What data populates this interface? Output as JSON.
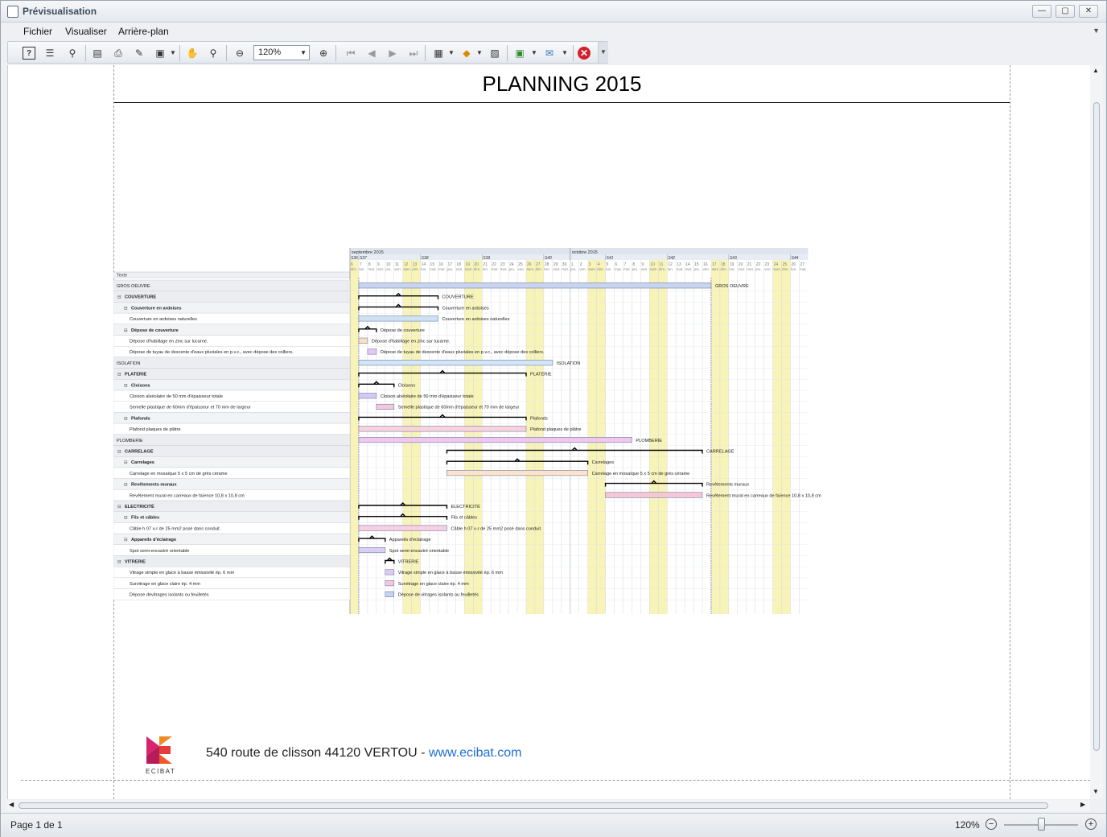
{
  "window": {
    "title": "Prévisualisation",
    "icon": "preview-icon"
  },
  "menu": {
    "items": [
      "Fichier",
      "Visualiser",
      "Arrière-plan"
    ]
  },
  "toolbar": {
    "zoom_value": "120%",
    "icons": [
      "help-icon",
      "document-map-icon",
      "find-icon",
      "page-setup-icon",
      "print-icon",
      "quick-print-icon",
      "export-icon",
      "hand-tool-icon",
      "magnifier-icon",
      "zoom-out-icon",
      "zoom-in-icon",
      "first-page-icon",
      "previous-page-icon",
      "next-page-icon",
      "last-page-icon",
      "multiple-pages-icon",
      "background-color-icon",
      "watermark-icon",
      "export-document-icon",
      "send-email-icon",
      "close-preview-icon"
    ]
  },
  "document": {
    "title": "PLANNING 2015",
    "footer_address": "540 route de clisson 44120 VERTOU - ",
    "footer_link": "www.ecibat.com",
    "logo_text": "ECIBAT",
    "logo_colors": [
      "#d6246e",
      "#f08a24",
      "#e43b3b",
      "#b71c5a"
    ]
  },
  "gantt": {
    "months": [
      "septembre 2015",
      "octobre 2015"
    ],
    "weeks": [
      {
        "label": "S36",
        "day": 6
      },
      {
        "label": "S37",
        "day": 7
      },
      {
        "label": "S38",
        "day": 14
      },
      {
        "label": "S39",
        "day": 21
      },
      {
        "label": "S40",
        "day": 28
      },
      {
        "label": "S41",
        "day": 5
      },
      {
        "label": "S42",
        "day": 12
      },
      {
        "label": "S43",
        "day": 19
      },
      {
        "label": "S44",
        "day": 26
      }
    ],
    "day_numbers": [
      "6",
      "7",
      "8",
      "9",
      "10",
      "11",
      "12",
      "13",
      "14",
      "15",
      "16",
      "17",
      "18",
      "19",
      "20",
      "21",
      "22",
      "23",
      "24",
      "25",
      "26",
      "27",
      "28",
      "29",
      "30",
      "1",
      "2",
      "3",
      "4",
      "5",
      "6",
      "7",
      "8",
      "9",
      "10",
      "11",
      "12",
      "13",
      "14",
      "15",
      "16",
      "17",
      "18",
      "19",
      "20",
      "21",
      "22",
      "23",
      "24",
      "25",
      "26",
      "27"
    ],
    "day_names": [
      "dim.",
      "lun.",
      "mar.",
      "mer.",
      "jeu.",
      "ven.",
      "sam.",
      "dim.",
      "lun.",
      "mar.",
      "mer.",
      "jeu.",
      "ven.",
      "sam.",
      "dim.",
      "lun.",
      "mar.",
      "mer.",
      "jeu.",
      "ven.",
      "sam.",
      "dim.",
      "lun.",
      "mar.",
      "mer.",
      "jeu.",
      "ven.",
      "sam.",
      "dim.",
      "lun.",
      "mar.",
      "mer.",
      "jeu.",
      "ven.",
      "sam.",
      "dim.",
      "lun.",
      "mar.",
      "mer.",
      "jeu.",
      "ven.",
      "sam.",
      "dim.",
      "lun.",
      "mar.",
      "mer.",
      "jeu.",
      "ven.",
      "sam.",
      "dim.",
      "lun.",
      "mar."
    ],
    "column_header": "Texte",
    "rows": [
      {
        "label": "GROS OEUVRE",
        "level": 0,
        "bold": false,
        "kind": "bar",
        "start": 1,
        "end": 41,
        "fill": "#c9d4ef",
        "bar_label": "GROS OEUVRE"
      },
      {
        "label": "COUVERTURE",
        "level": 0,
        "bold": true,
        "kind": "summary",
        "start": 1,
        "end": 10,
        "bar_label": "COUVERTURE"
      },
      {
        "label": "Couverture en ardoises",
        "level": 1,
        "bold": true,
        "kind": "summary",
        "start": 1,
        "end": 10,
        "bar_label": "Couverture en ardoises"
      },
      {
        "label": "Couverture en ardoises naturelles",
        "level": 2,
        "bold": false,
        "kind": "bar",
        "start": 1,
        "end": 10,
        "fill": "#cfe2f3",
        "bar_label": "Couverture en ardoises naturelles"
      },
      {
        "label": "Dépose de couverture",
        "level": 1,
        "bold": true,
        "kind": "summary",
        "start": 1,
        "end": 3,
        "bar_label": "Dépose de couverture"
      },
      {
        "label": "Dépose d'habillage en zinc sur lucarne.",
        "level": 2,
        "bold": false,
        "kind": "bar",
        "start": 1,
        "end": 2,
        "fill": "#fde0c4",
        "bar_label": "Dépose d'habillage en zinc sur lucarne."
      },
      {
        "label": "Dépose de tuyau de descente d'eaux pluviales en p.v.c., avec dépose des colliers.",
        "level": 2,
        "bold": false,
        "kind": "bar",
        "start": 2,
        "end": 3,
        "fill": "#e7c6f3",
        "bar_label": "Dépose de tuyau de descente d'eaux pluviales en p.v.c., avec dépose des colliers."
      },
      {
        "label": "ISOLATION",
        "level": 0,
        "bold": false,
        "kind": "bar",
        "start": 1,
        "end": 23,
        "fill": "#d3e6f5",
        "bar_label": "ISOLATION"
      },
      {
        "label": "PLATERIE",
        "level": 0,
        "bold": true,
        "kind": "summary",
        "start": 1,
        "end": 20,
        "bar_label": "PLATERIE"
      },
      {
        "label": "Cloisons",
        "level": 1,
        "bold": true,
        "kind": "summary",
        "start": 1,
        "end": 5,
        "bar_label": "Cloisons"
      },
      {
        "label": "Cloison alvéolaire de 50 mm d'épaisseur totale",
        "level": 2,
        "bold": false,
        "kind": "bar",
        "start": 1,
        "end": 3,
        "fill": "#d7c9f3",
        "bar_label": "Cloison alvéolaire de 50 mm d'épaisseur totale"
      },
      {
        "label": "Semelle plastique de 60mm d'épaisseur et 70 mm de largeur",
        "level": 2,
        "bold": false,
        "kind": "bar",
        "start": 3,
        "end": 5,
        "fill": "#f6c6dd",
        "bar_label": "Semelle plastique de 60mm d'épaisseur et 70 mm de largeur"
      },
      {
        "label": "Plafonds",
        "level": 1,
        "bold": true,
        "kind": "summary",
        "start": 1,
        "end": 20,
        "bar_label": "Plafonds"
      },
      {
        "label": "Plafond plaques de plâtre",
        "level": 2,
        "bold": false,
        "kind": "bar",
        "start": 1,
        "end": 20,
        "fill": "#f9d3dc",
        "bar_label": "Plafond plaques de plâtre"
      },
      {
        "label": "PLOMBERIE",
        "level": 0,
        "bold": false,
        "kind": "bar",
        "start": 1,
        "end": 32,
        "fill": "#f0c8ef",
        "bar_label": "PLOMBERIE"
      },
      {
        "label": "CARRELAGE",
        "level": 0,
        "bold": true,
        "kind": "summary",
        "start": 11,
        "end": 40,
        "bar_label": "CARRELAGE"
      },
      {
        "label": "Carrelages",
        "level": 1,
        "bold": true,
        "kind": "summary",
        "start": 11,
        "end": 27,
        "bar_label": "Carrelages"
      },
      {
        "label": "Carrelage en mosaïque 5 x 5 cm de grès cérame",
        "level": 2,
        "bold": false,
        "kind": "bar",
        "start": 11,
        "end": 27,
        "fill": "#fde3cc",
        "bar_label": "Carrelage en mosaïque 5 x 5 cm de grès cérame"
      },
      {
        "label": "Revêtements muraux",
        "level": 1,
        "bold": true,
        "kind": "summary",
        "start": 29,
        "end": 40,
        "bar_label": "Revêtements muraux"
      },
      {
        "label": "Revêtement mural en carreaux de faïence 10,8 x 10,8 cm",
        "level": 2,
        "bold": false,
        "kind": "bar",
        "start": 29,
        "end": 40,
        "fill": "#f8c7d5",
        "bar_label": "Revêtement mural en carreaux de faïence 10,8 x 10,8 cm"
      },
      {
        "label": "ELECTRICITÉ",
        "level": 0,
        "bold": true,
        "kind": "summary",
        "start": 1,
        "end": 11,
        "bar_label": "ELECTRICITÉ"
      },
      {
        "label": "Fils et câbles",
        "level": 1,
        "bold": true,
        "kind": "summary",
        "start": 1,
        "end": 11,
        "bar_label": "Fils et câbles"
      },
      {
        "label": "Câble h 07 v-r de 25 mm2 posé dans conduit.",
        "level": 2,
        "bold": false,
        "kind": "bar",
        "start": 1,
        "end": 11,
        "fill": "#f9cfe2",
        "bar_label": "Câble h 07 v-r de 25 mm2 posé dans conduit."
      },
      {
        "label": "Appareils d'éclairage",
        "level": 1,
        "bold": true,
        "kind": "summary",
        "start": 1,
        "end": 4,
        "bar_label": "Appareils d'éclairage"
      },
      {
        "label": "Spot semi-encastré orientable",
        "level": 2,
        "bold": false,
        "kind": "bar",
        "start": 1,
        "end": 4,
        "fill": "#dccdf5",
        "bar_label": "Spot semi-encastré orientable"
      },
      {
        "label": "VITRERIE",
        "level": 0,
        "bold": true,
        "kind": "summary",
        "start": 4,
        "end": 5,
        "bar_label": "VITRERIE"
      },
      {
        "label": "Vitrage simple en glace à basse émissivité ép. 6 mm",
        "level": 2,
        "bold": false,
        "kind": "bar",
        "start": 4,
        "end": 5,
        "fill": "#e3c8f5",
        "bar_label": "Vitrage simple en glace à basse émissivité ép. 6 mm"
      },
      {
        "label": "Survitrage en glace claire ép. 4 mm",
        "level": 2,
        "bold": false,
        "kind": "bar",
        "start": 4,
        "end": 5,
        "fill": "#f6c7dc",
        "bar_label": "Survitrage en glace claire ép. 4 mm"
      },
      {
        "label": "Dépose devitrages isolants ou feuilletés",
        "level": 2,
        "bold": false,
        "kind": "bar",
        "start": 4,
        "end": 5,
        "fill": "#c9d2f3",
        "bar_label": "Dépose de vitrages isolants ou feuilletés"
      }
    ]
  },
  "statusbar": {
    "page": "Page 1 de 1",
    "zoom": "120%"
  }
}
